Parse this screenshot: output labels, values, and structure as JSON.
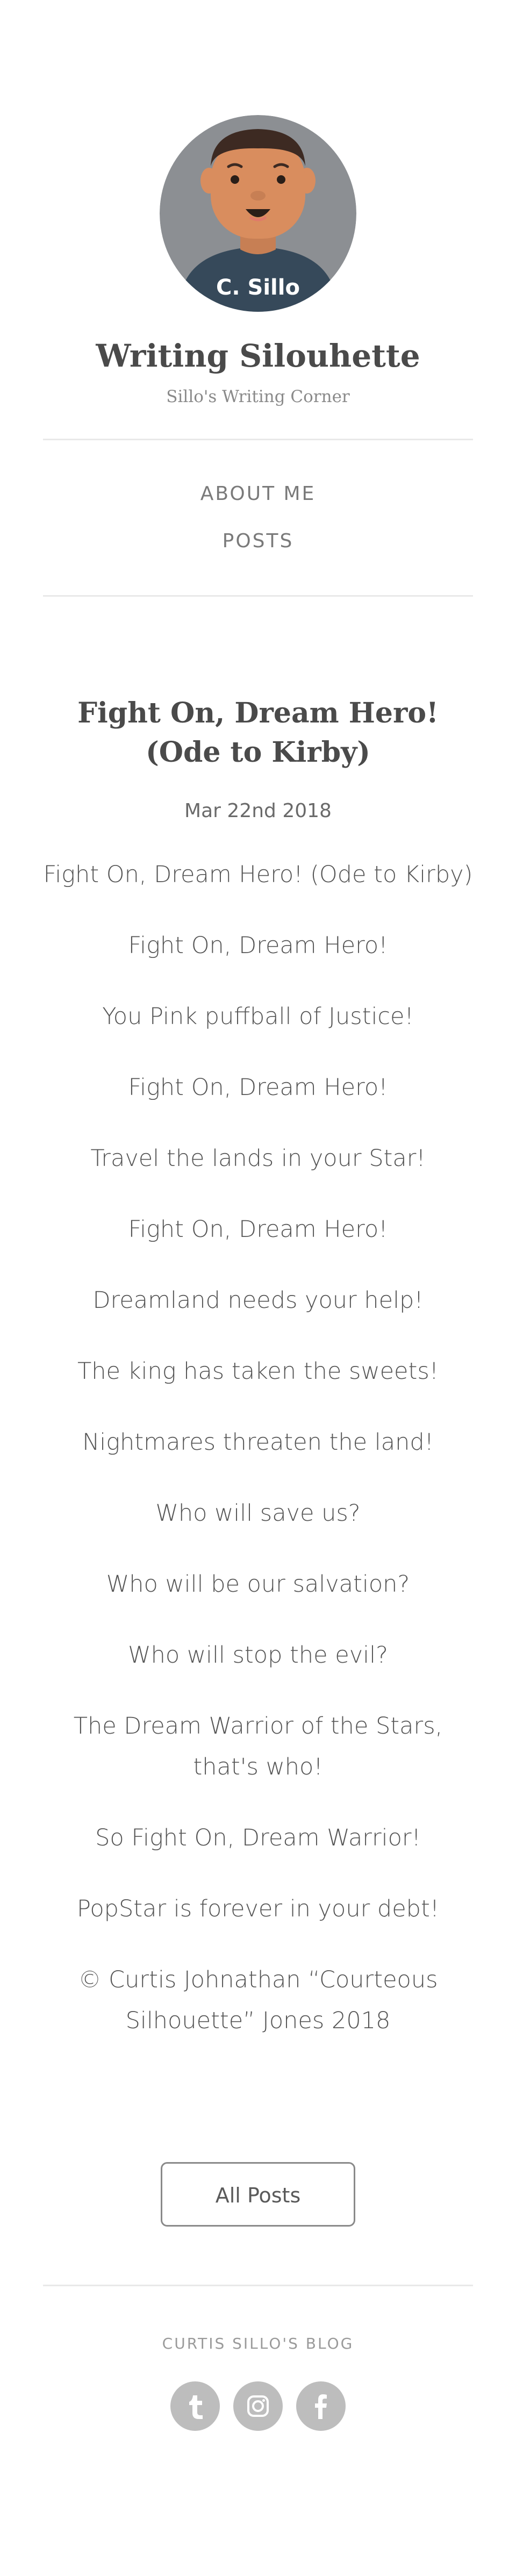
{
  "site": {
    "avatar_label": "C. Sillo",
    "title": "Writing Silouhette",
    "subtitle": "Sillo's Writing Corner"
  },
  "nav": {
    "items": [
      {
        "label": "ABOUT ME"
      },
      {
        "label": "POSTS"
      }
    ]
  },
  "post": {
    "title": "Fight On, Dream Hero! (Ode to Kirby)",
    "date": "Mar 22nd 2018",
    "lines": [
      "Fight On, Dream Hero! (Ode to Kirby)",
      "Fight On, Dream Hero!",
      "You Pink puffball of Justice!",
      "Fight On, Dream Hero!",
      "Travel the lands in your Star!",
      "Fight On, Dream Hero!",
      "Dreamland needs your help!",
      "The king has taken the sweets!",
      "Nightmares threaten the land!",
      "Who will save us?",
      "Who will be our salvation?",
      "Who will stop the evil?",
      "The Dream Warrior of the Stars, that's who!",
      "So Fight On, Dream Warrior!",
      "PopStar is forever in your debt!",
      "© Curtis Johnathan “Courteous Silhouette” Jones 2018"
    ]
  },
  "buttons": {
    "all_posts": "All Posts"
  },
  "footer": {
    "brand": "CURTIS SILLO'S BLOG",
    "social": [
      {
        "icon": "tumblr-icon"
      },
      {
        "icon": "instagram-icon"
      },
      {
        "icon": "facebook-icon"
      }
    ]
  },
  "colors": {
    "avatar_bg": "#8c8f93",
    "skin": "#d98d5e",
    "shirt": "#36495a",
    "social_bg": "#bdbdbd"
  }
}
